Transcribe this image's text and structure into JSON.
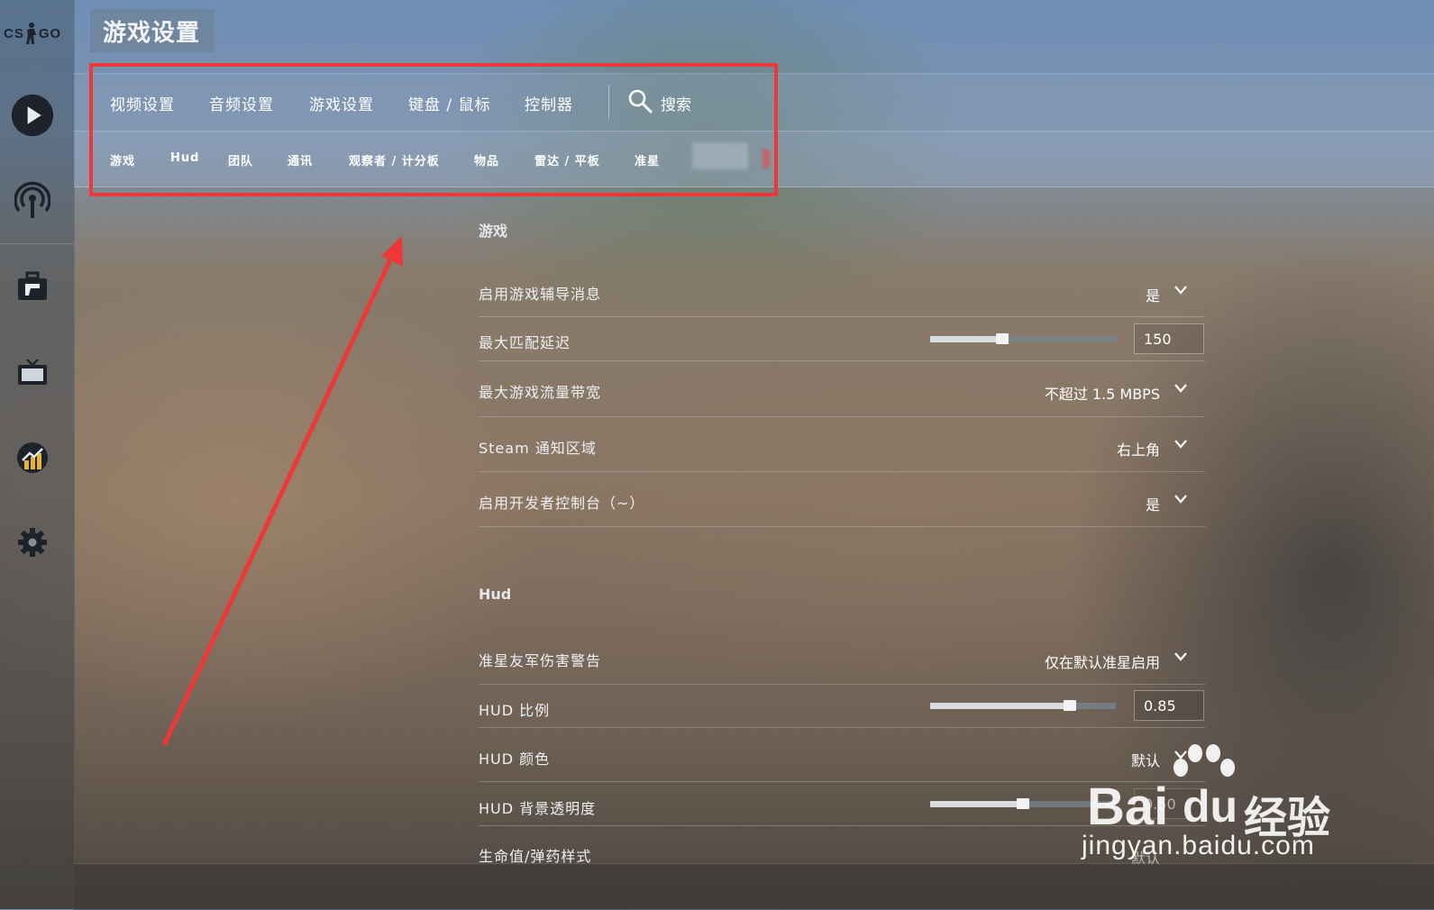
{
  "sidebar": {
    "logo_left": "CS",
    "logo_right": "GO",
    "icons": [
      "play-icon",
      "antenna-icon",
      "briefcase-icon",
      "tv-icon",
      "stats-icon",
      "gear-icon"
    ]
  },
  "header": {
    "title": "游戏设置"
  },
  "main_tabs": [
    "视频设置",
    "音频设置",
    "游戏设置",
    "键盘 / 鼠标",
    "控制器"
  ],
  "search_label": "搜索",
  "sub_tabs": [
    "游戏",
    "Hud",
    "团队",
    "通讯",
    "观察者 / 计分板",
    "物品",
    "雷达 / 平板",
    "准星"
  ],
  "sections": {
    "game": {
      "title": "游戏",
      "rows": [
        {
          "label": "启用游戏辅导消息",
          "value": "是"
        },
        {
          "label": "最大匹配延迟",
          "value": "150",
          "level": 0.39
        },
        {
          "label": "最大游戏流量带宽",
          "value": "不超过 1.5 MBPS"
        },
        {
          "label": "Steam 通知区域",
          "value": "右上角"
        },
        {
          "label": "启用开发者控制台（~）",
          "value": "是"
        }
      ]
    },
    "hud": {
      "title": "Hud",
      "rows": [
        {
          "label": "准星友军伤害警告",
          "value": "仅在默认准星启用"
        },
        {
          "label": "HUD 比例",
          "value": "0.85",
          "level": 0.75
        },
        {
          "label": "HUD 颜色",
          "value": "默认"
        },
        {
          "label": "HUD 背景透明度",
          "value": "0.50",
          "level": 0.5
        },
        {
          "label": "生命值/弹药样式",
          "value": "默认"
        }
      ]
    }
  },
  "watermark": {
    "brand_a": "Bai",
    "brand_b": "du",
    "brand_c": "经验",
    "url": "jingyan.baidu.com"
  },
  "colors": {
    "highlight": "#ee3737",
    "text": "#ffffff"
  }
}
